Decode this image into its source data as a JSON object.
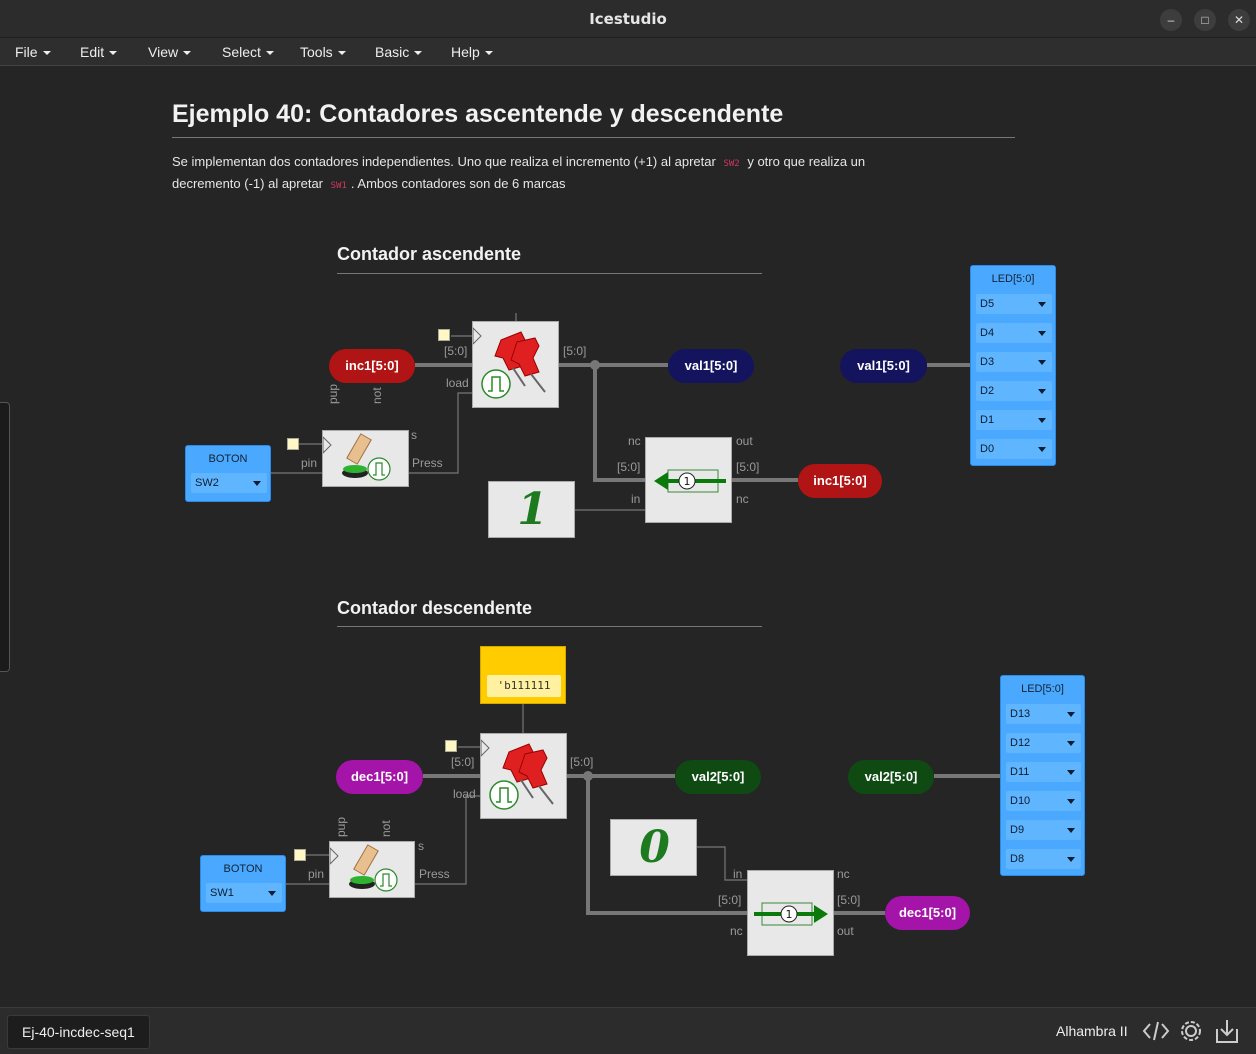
{
  "window": {
    "title": "Icestudio"
  },
  "menubar": [
    "File",
    "Edit",
    "View",
    "Select",
    "Tools",
    "Basic",
    "Help"
  ],
  "doc": {
    "title": "Ejemplo 40: Contadores ascentende y descendente",
    "para1": "Se implementan dos contadores independientes. Uno que realiza el incremento (+1) al apretar",
    "code1": "SW2",
    "para2": "y otro que realiza un",
    "para3": "decremento (-1) al apretar",
    "code2": "SW1",
    "para4": ". Ambos contadores son de 6 marcas",
    "section1": "Contador ascendente",
    "section2": "Contador descendente"
  },
  "circuit1": {
    "inc_in": "inc1[5:0]",
    "val_out": "val1[5:0]",
    "val_in": "val1[5:0]",
    "inc_out": "inc1[5:0]",
    "const": "1",
    "reg_in_bus": "[5:0]",
    "reg_out_bus": "[5:0]",
    "reg_load": "load",
    "btn_pup": "pup",
    "btn_not": "not",
    "btn_s": "s",
    "btn_pin": "pin",
    "btn_press": "Press",
    "add_nc_top": "nc",
    "add_out": "out",
    "add_bus_in": "[5:0]",
    "add_bus_out": "[5:0]",
    "add_in": "in",
    "add_nc_bottom": "nc",
    "add_mark": "1",
    "boton": {
      "title": "BOTON",
      "value": "SW2"
    },
    "led": {
      "title": "LED[5:0]",
      "items": [
        "D5",
        "D4",
        "D3",
        "D2",
        "D1",
        "D0"
      ]
    }
  },
  "circuit2": {
    "dec_in": "dec1[5:0]",
    "val_out": "val2[5:0]",
    "val_in": "val2[5:0]",
    "dec_out": "dec1[5:0]",
    "const": "0",
    "init_value": "'b111111",
    "reg_in_bus": "[5:0]",
    "reg_out_bus": "[5:0]",
    "reg_load": "load",
    "btn_pup": "pup",
    "btn_not": "not",
    "btn_s": "s",
    "btn_pin": "pin",
    "btn_press": "Press",
    "sub_in": "in",
    "sub_nc_top": "nc",
    "sub_bus_in": "[5:0]",
    "sub_bus_out": "[5:0]",
    "sub_nc_bottom": "nc",
    "sub_out": "out",
    "sub_mark": "1",
    "boton": {
      "title": "BOTON",
      "value": "SW1"
    },
    "led": {
      "title": "LED[5:0]",
      "items": [
        "D13",
        "D12",
        "D11",
        "D10",
        "D9",
        "D8"
      ]
    }
  },
  "statusbar": {
    "tab": "Ej-40-incdec-seq1",
    "board": "Alhambra II"
  },
  "colors": {
    "red_pill": "#b01414",
    "navy_pill": "#14145e",
    "purple_pill": "#a414a8",
    "green_pill": "#0e4a12",
    "io_blue": "#4aa9ff",
    "init_yellow": "#ffcc00"
  }
}
